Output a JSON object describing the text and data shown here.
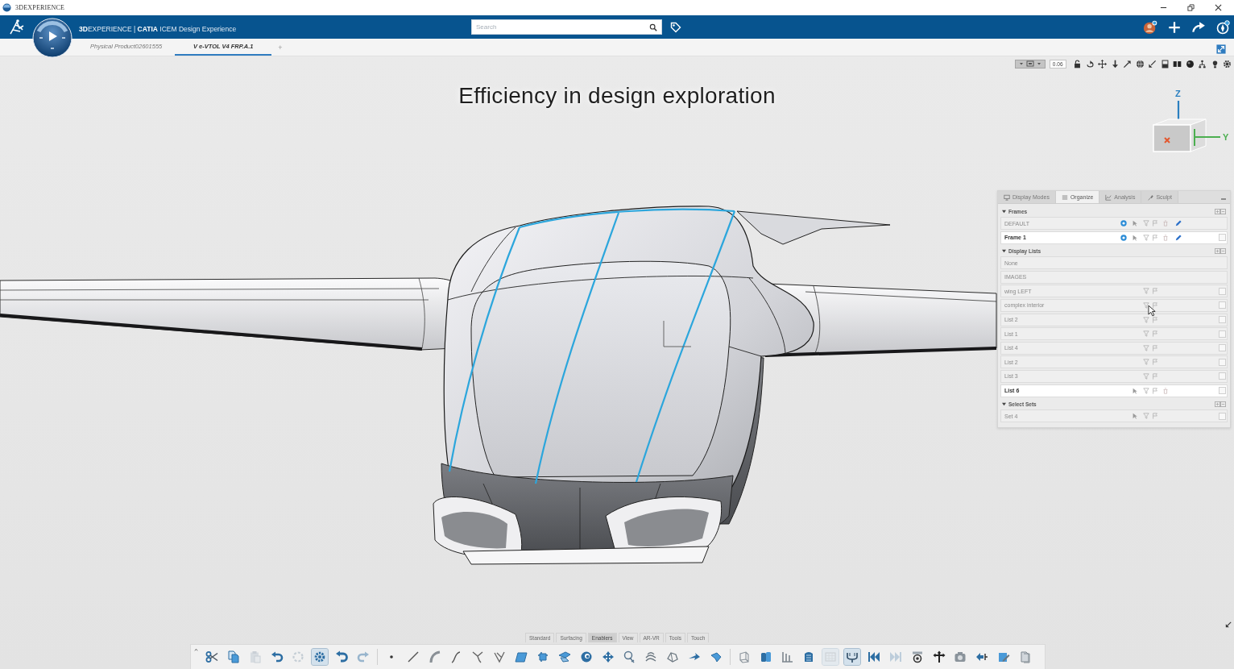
{
  "title_bar": {
    "app_name": "3DEXPERIENCE"
  },
  "header": {
    "title": "**3D**EXPERIENCE | **CATIA** ICEM Design Experience",
    "search": {
      "placeholder": "Search"
    }
  },
  "document_tabs": {
    "tabs": [
      {
        "label": "Physical Product02601555",
        "selected": false
      },
      {
        "label": "V e-VTOL V4 FRP.A.1",
        "selected": true
      }
    ],
    "add_tab": "+"
  },
  "view_toolbar": {
    "zoom_value": "0.06"
  },
  "caption": "Efficiency in design exploration",
  "view_cube": {
    "axes": [
      "Z",
      "Y"
    ]
  },
  "panel": {
    "tabs": [
      {
        "label": "Display Modes",
        "selected": false
      },
      {
        "label": "Organize",
        "selected": true
      },
      {
        "label": "Analysis",
        "selected": false
      },
      {
        "label": "Sculpt",
        "selected": false
      }
    ],
    "sections": [
      {
        "title": "Frames",
        "kind": "frames",
        "rows": [
          {
            "label": "DEFAULT",
            "selected": false
          },
          {
            "label": "Frame 1",
            "selected": true,
            "checked": false
          }
        ]
      },
      {
        "title": "Display Lists",
        "kind": "lists",
        "rows": [
          {
            "label": "None",
            "kind": "plain",
            "selected": false
          },
          {
            "label": "IMAGES",
            "kind": "plain",
            "selected": false
          },
          {
            "label": "wing LEFT",
            "kind": "list",
            "selected": false,
            "checked": false
          },
          {
            "label": "complex interior",
            "kind": "list",
            "selected": false,
            "checked": false
          },
          {
            "label": "List 2",
            "kind": "list",
            "selected": false,
            "checked": false
          },
          {
            "label": "List 1",
            "kind": "list",
            "selected": false,
            "checked": false
          },
          {
            "label": "List 4",
            "kind": "list",
            "selected": false,
            "checked": false
          },
          {
            "label": "List 2",
            "kind": "list",
            "selected": false,
            "checked": false
          },
          {
            "label": "List 3",
            "kind": "list",
            "selected": false,
            "checked": false
          },
          {
            "label": "List 6",
            "kind": "list",
            "selected": true,
            "checked": false
          }
        ]
      },
      {
        "title": "Select Sets",
        "kind": "sets",
        "rows": [
          {
            "label": "Set 4",
            "selected": false,
            "checked": false
          }
        ]
      }
    ]
  },
  "action_bar": {
    "tabs": [
      {
        "label": "Standard",
        "selected": false
      },
      {
        "label": "Surfacing",
        "selected": false
      },
      {
        "label": "Enablers",
        "selected": true
      },
      {
        "label": "View",
        "selected": false
      },
      {
        "label": "AR-VR",
        "selected": false
      },
      {
        "label": "Tools",
        "selected": false
      },
      {
        "label": "Touch",
        "selected": false
      }
    ],
    "tools": [
      {
        "pressed": false,
        "disabled": false
      },
      {
        "pressed": false,
        "disabled": false
      },
      {
        "pressed": false,
        "disabled": true
      },
      {
        "pressed": false,
        "disabled": false
      },
      {
        "pressed": false,
        "disabled": true
      },
      {
        "pressed": true,
        "disabled": false
      },
      {
        "pressed": false,
        "disabled": false
      },
      {
        "pressed": false,
        "disabled": true
      },
      {
        "pressed": false,
        "disabled": false
      },
      {
        "pressed": false,
        "disabled": false
      },
      {
        "pressed": false,
        "disabled": false
      },
      {
        "pressed": false,
        "disabled": false
      },
      {
        "pressed": false,
        "disabled": false
      },
      {
        "pressed": false,
        "disabled": false
      },
      {
        "pressed": false,
        "disabled": false
      },
      {
        "pressed": false,
        "disabled": false
      },
      {
        "pressed": false,
        "disabled": false
      },
      {
        "pressed": false,
        "disabled": false
      },
      {
        "pressed": false,
        "disabled": false
      },
      {
        "pressed": false,
        "disabled": false
      },
      {
        "pressed": false,
        "disabled": false
      },
      {
        "pressed": false,
        "disabled": false
      },
      {
        "pressed": false,
        "disabled": false
      },
      {
        "pressed": false,
        "disabled": false
      },
      {
        "pressed": false,
        "disabled": false
      },
      {
        "pressed": false,
        "disabled": false
      },
      {
        "pressed": false,
        "disabled": false
      },
      {
        "pressed": false,
        "disabled": false
      },
      {
        "pressed": true,
        "disabled": true
      },
      {
        "pressed": true,
        "disabled": false
      },
      {
        "pressed": false,
        "disabled": false
      },
      {
        "pressed": false,
        "disabled": true
      },
      {
        "pressed": false,
        "disabled": false
      },
      {
        "pressed": false,
        "disabled": false
      },
      {
        "pressed": false,
        "disabled": false
      },
      {
        "pressed": false,
        "disabled": false
      },
      {
        "pressed": false,
        "disabled": false
      },
      {
        "pressed": false,
        "disabled": false
      }
    ]
  }
}
